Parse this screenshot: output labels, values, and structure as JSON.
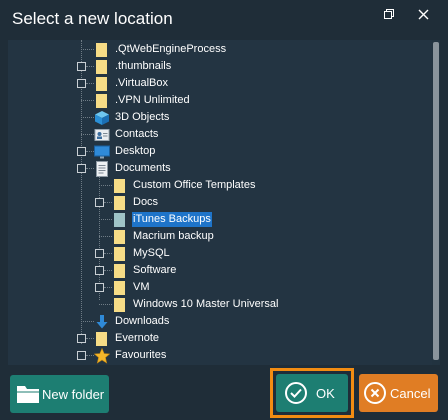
{
  "dialog": {
    "title": "Select a new location"
  },
  "tree": {
    "items": [
      {
        "label": ".QtWebEngineProcess",
        "icon": "folder-icon"
      },
      {
        "label": ".thumbnails",
        "icon": "folder-icon",
        "expandable": true
      },
      {
        "label": ".VirtualBox",
        "icon": "folder-icon",
        "expandable": true
      },
      {
        "label": ".VPN Unlimited",
        "icon": "folder-icon"
      },
      {
        "label": "3D Objects",
        "icon": "3d-objects-icon"
      },
      {
        "label": "Contacts",
        "icon": "contacts-icon"
      },
      {
        "label": "Desktop",
        "icon": "desktop-icon",
        "expandable": true
      },
      {
        "label": "Documents",
        "icon": "documents-icon",
        "expanded": true
      },
      {
        "label": "Custom Office Templates",
        "icon": "folder-icon"
      },
      {
        "label": "Docs",
        "icon": "folder-icon",
        "expandable": true
      },
      {
        "label": "iTunes Backups",
        "icon": "folder-open-icon",
        "selected": true
      },
      {
        "label": "Macrium backup",
        "icon": "folder-icon"
      },
      {
        "label": "MySQL",
        "icon": "folder-icon",
        "expandable": true
      },
      {
        "label": "Software",
        "icon": "folder-icon",
        "expandable": true
      },
      {
        "label": "VM",
        "icon": "folder-icon",
        "expandable": true
      },
      {
        "label": "Windows 10 Master Universal",
        "icon": "folder-icon"
      },
      {
        "label": "Downloads",
        "icon": "downloads-icon"
      },
      {
        "label": "Evernote",
        "icon": "folder-icon",
        "expandable": true
      },
      {
        "label": "Favourites",
        "icon": "favourites-icon",
        "expandable": true
      }
    ]
  },
  "buttons": {
    "new_folder": "New folder",
    "ok": "OK",
    "cancel": "Cancel"
  },
  "colors": {
    "background": "#1f2d38",
    "panel": "#233442",
    "accent_green": "#1d7e72",
    "accent_orange": "#e07d24",
    "highlight_frame": "#f28c12",
    "selection": "#1e74c9"
  }
}
